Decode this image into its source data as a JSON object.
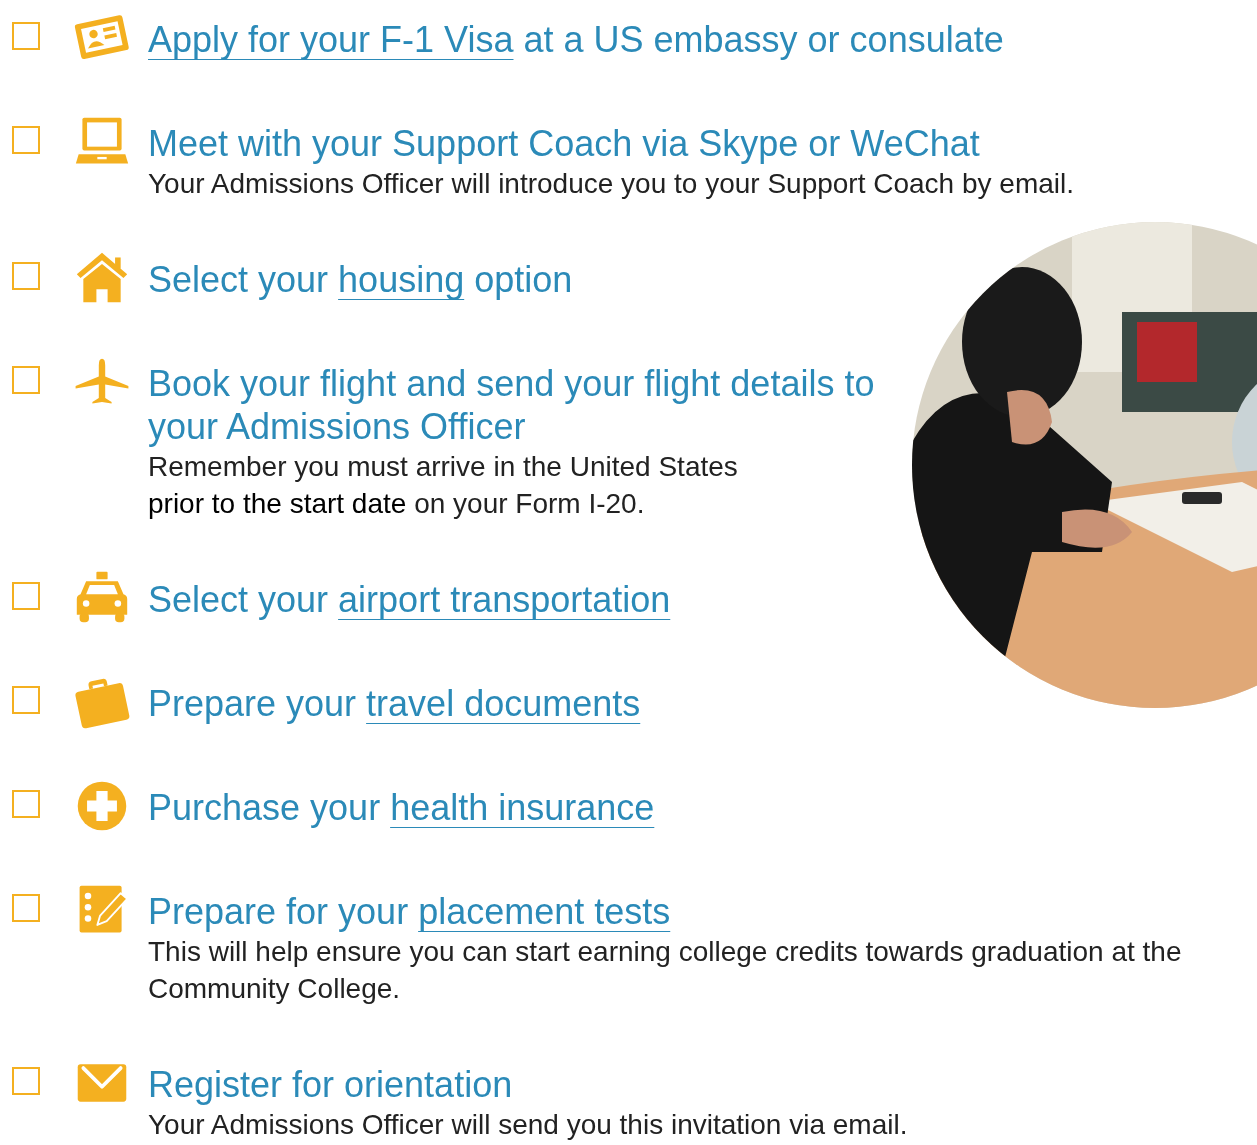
{
  "checklist": [
    {
      "kind": "id-card",
      "checked": false,
      "title": [
        {
          "text": "Apply for your F-1 Visa",
          "link": true
        },
        {
          "text": " at a US embassy or consulate",
          "link": false
        }
      ]
    },
    {
      "kind": "laptop",
      "checked": false,
      "title": [
        {
          "text": "Meet with your Support Coach via Skype or WeChat",
          "link": false
        }
      ],
      "note": [
        "Your Admissions Officer will introduce you to your Support Coach by email."
      ]
    },
    {
      "kind": "house",
      "checked": false,
      "title": [
        {
          "text": "Select your ",
          "link": false
        },
        {
          "text": "housing",
          "link": true
        },
        {
          "text": " option",
          "link": false
        }
      ]
    },
    {
      "kind": "plane",
      "checked": false,
      "title": [
        {
          "text": "Book your flight and send your flight details to your Admissions Officer",
          "link": false
        }
      ],
      "note": [
        "Remember you must arrive in the United States",
        "**prior to the start date** on your Form I-20."
      ]
    },
    {
      "kind": "taxi",
      "checked": false,
      "title": [
        {
          "text": "Select your ",
          "link": false
        },
        {
          "text": "airport transportation",
          "link": true
        }
      ]
    },
    {
      "kind": "suitcase",
      "checked": false,
      "title": [
        {
          "text": "Prepare your ",
          "link": false
        },
        {
          "text": "travel documents",
          "link": true
        }
      ]
    },
    {
      "kind": "plus",
      "checked": false,
      "title": [
        {
          "text": "Purchase your ",
          "link": false
        },
        {
          "text": "health insurance",
          "link": true
        }
      ]
    },
    {
      "kind": "checklist",
      "checked": false,
      "title": [
        {
          "text": "Prepare for your ",
          "link": false
        },
        {
          "text": "placement tests",
          "link": true
        }
      ],
      "note": [
        "This will help ensure you can start earning college credits towards graduation at the Community College."
      ]
    },
    {
      "kind": "envelope",
      "checked": false,
      "title": [
        {
          "text": "Register for orientation",
          "link": false
        }
      ],
      "note": [
        "Your Admissions Officer will send you this invitation via email."
      ]
    }
  ]
}
